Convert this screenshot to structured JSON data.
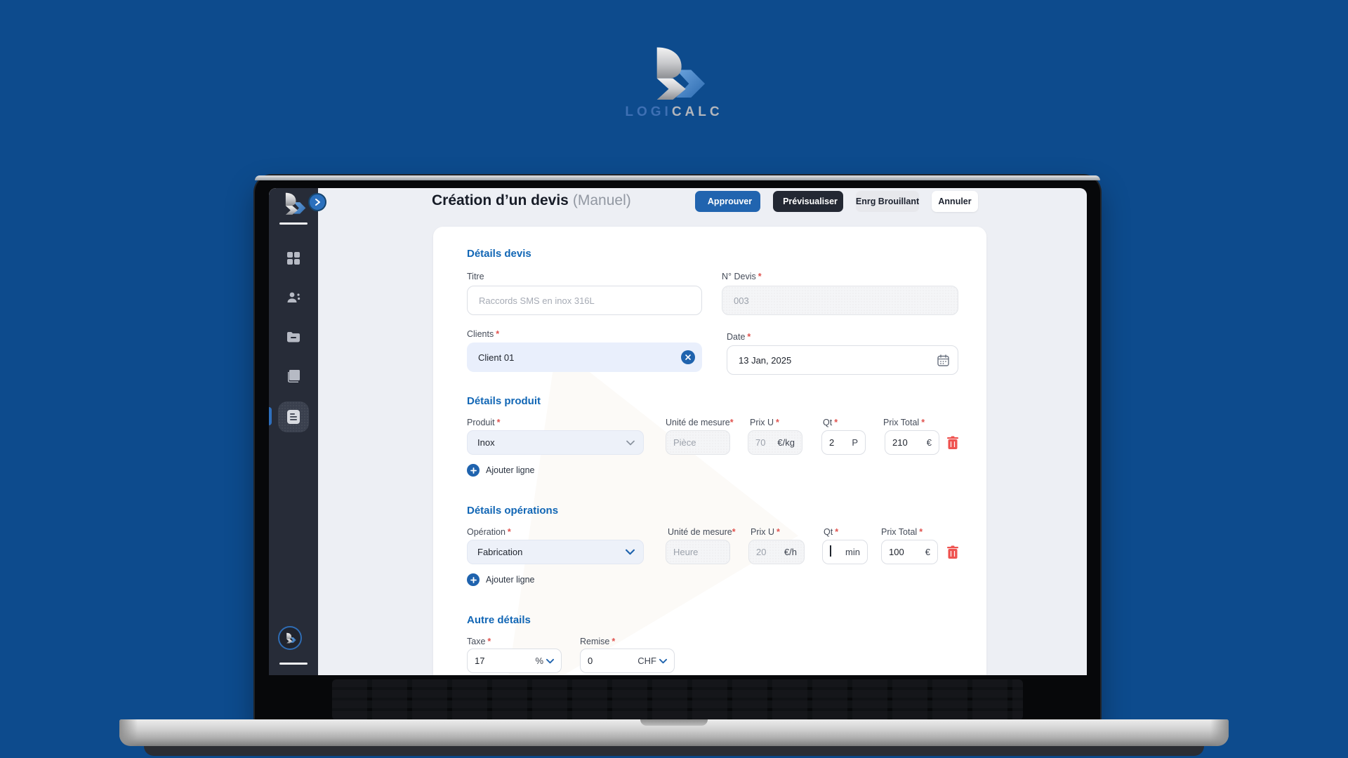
{
  "brand": {
    "logo_part1": "LOGI",
    "logo_part2": "CALC"
  },
  "header": {
    "title": "Création d’un devis",
    "mode": "(Manuel)",
    "approve": "Approuver",
    "preview": "Prévisualiser",
    "draft": "Enrg Brouillant",
    "cancel": "Annuler"
  },
  "required_marker": "*",
  "form": {
    "devis": {
      "title": "Détails devis",
      "titre_label": "Titre",
      "titre_placeholder": "Raccords SMS en inox 316L",
      "num_label": "N° Devis",
      "num_value": "003",
      "clients_label": "Clients",
      "clients_value": "Client 01",
      "date_label": "Date",
      "date_value": "13 Jan, 2025"
    },
    "produit": {
      "title": "Détails produit",
      "item_label": "Produit",
      "item_value": "Inox",
      "unit_label": "Unité de mesure",
      "unit_placeholder": "Pièce",
      "price_label": "Prix U",
      "price_value": "70",
      "price_suffix": "€/kg",
      "qty_label": "Qt",
      "qty_value": "2",
      "qty_suffix": "P",
      "total_label": "Prix Total",
      "total_value": "210",
      "total_suffix": "€",
      "add_line": "Ajouter ligne"
    },
    "operations": {
      "title": "Détails opérations",
      "item_label": "Opération",
      "item_value": "Fabrication",
      "unit_label": "Unité de mesure",
      "unit_placeholder": "Heure",
      "price_label": "Prix U",
      "price_value": "20",
      "price_suffix": "€/h",
      "qty_label": "Qt",
      "qty_value": "",
      "qty_suffix": "min",
      "total_label": "Prix Total",
      "total_value": "100",
      "total_suffix": "€",
      "add_line": "Ajouter ligne"
    },
    "autre": {
      "title": "Autre détails",
      "taxe_label": "Taxe",
      "taxe_value": "17",
      "taxe_suffix": "%",
      "remise_label": "Remise",
      "remise_value": "0",
      "remise_suffix": "CHF"
    }
  },
  "colors": {
    "accent": "#2065b0",
    "page_bg": "#0d4b8d",
    "danger": "#ef5350",
    "section_title": "#1166b5"
  }
}
